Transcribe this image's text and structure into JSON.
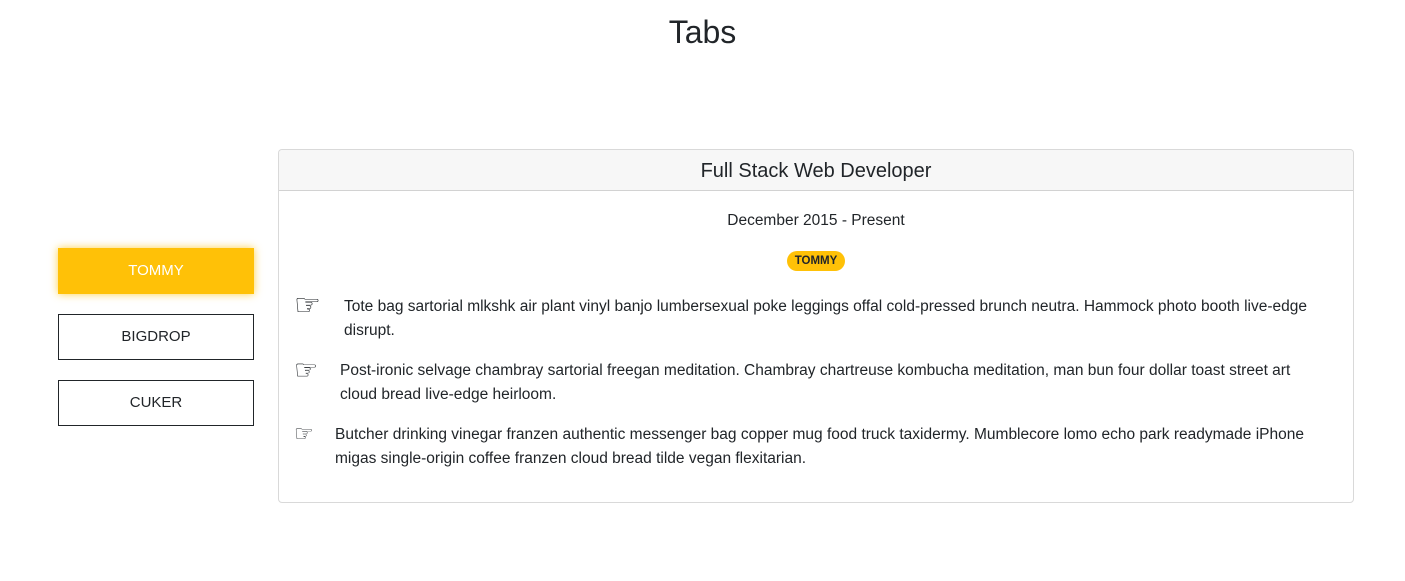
{
  "page": {
    "title": "Tabs"
  },
  "tabs": [
    {
      "label": "TOMMY",
      "active": true
    },
    {
      "label": "BIGDROP",
      "active": false
    },
    {
      "label": "CUKER",
      "active": false
    }
  ],
  "card": {
    "title": "Full Stack Web Developer",
    "date": "December 2015 - Present",
    "badge": "TOMMY",
    "items": [
      {
        "icon": "pointing-hand-icon",
        "text": "Tote bag sartorial mlkshk air plant vinyl banjo lumbersexual poke leggings offal cold-pressed brunch neutra. Hammock photo booth live-edge disrupt."
      },
      {
        "icon": "pointing-hand-icon",
        "text": "Post-ironic selvage chambray sartorial freegan meditation. Chambray chartreuse kombucha meditation, man bun four dollar toast street art cloud bread live-edge heirloom."
      },
      {
        "icon": "pointing-hand-icon",
        "text": "Butcher drinking vinegar franzen authentic messenger bag copper mug food truck taxidermy. Mumblecore lomo echo park readymade iPhone migas single-origin coffee franzen cloud bread tilde vegan flexitarian."
      }
    ]
  },
  "colors": {
    "accent": "#ffc107",
    "text": "#212529",
    "card_header_bg": "#f7f7f7"
  }
}
